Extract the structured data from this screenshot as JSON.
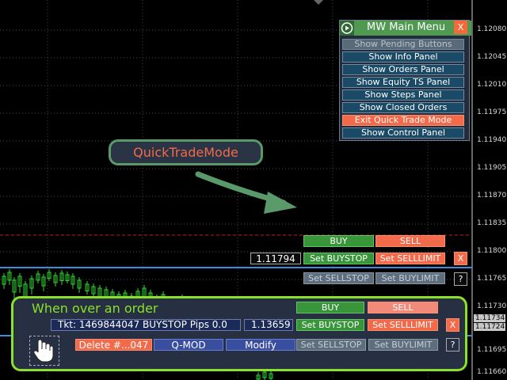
{
  "colors": {
    "background": "#000000",
    "candle": "#2fd62f",
    "accent_green": "#4f9a50",
    "accent_red": "#f26a4a",
    "highlight": "#8ae02a"
  },
  "price_axis": {
    "labels": [
      "1.12080",
      "1.12045",
      "1.12010",
      "1.11975",
      "1.11940",
      "1.11905",
      "1.11870",
      "1.11835",
      "1.11800",
      "1.11765",
      "1.11730",
      "1.11695",
      "1.11660"
    ],
    "current_price_1": "1.11734",
    "current_price_2": "1.11724"
  },
  "menu": {
    "title": "MW Main Menu",
    "close": "X",
    "icon": "play-circle-icon",
    "items": [
      {
        "label": "Show Pending Buttons"
      },
      {
        "label": "Show Info Panel"
      },
      {
        "label": "Show Orders Panel"
      },
      {
        "label": "Show Equity TS Panel"
      },
      {
        "label": "Show Steps Panel"
      },
      {
        "label": "Show Closed Orders"
      },
      {
        "label": "Exit Quick Trade Mode"
      },
      {
        "label": "Show Control Panel"
      }
    ]
  },
  "callout": {
    "text": "QuickTradeMode"
  },
  "quick_trade": {
    "buy": "BUY",
    "sell": "SELL",
    "price": "1.11794",
    "set_buystop": "Set BUYSTOP",
    "set_selllimit": "Set SELLLIMIT",
    "close": "X",
    "set_sellstop": "Set SELLSTOP",
    "set_buylimit": "Set BUYLIMIT",
    "help": "?"
  },
  "order_panel": {
    "title": "When over an order",
    "ticket": "Tkt: 1469844047 BUYSTOP Pips 0.0",
    "price": "1.13659",
    "buy": "BUY",
    "sell": "SELL",
    "set_buystop": "Set BUYSTOP",
    "set_selllimit": "Set SELLLIMIT",
    "close": "X",
    "delete": "Delete #...047",
    "qmod": "Q-MOD",
    "modify": "Modify",
    "set_sellstop": "Set SELLSTOP",
    "set_buylimit": "Set BUYLIMIT",
    "help": "?",
    "hand_icon": "hand-pointer-icon"
  }
}
